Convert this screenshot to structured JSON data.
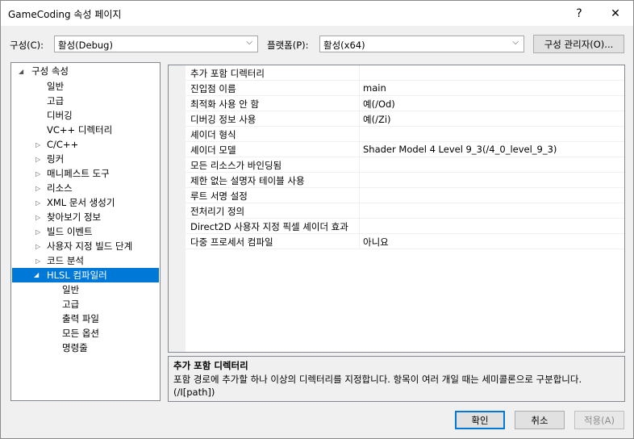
{
  "window": {
    "title": "GameCoding 속성 페이지",
    "help_glyph": "?",
    "close_glyph": "✕"
  },
  "toolbar": {
    "config_label": "구성(C):",
    "config_value": "활성(Debug)",
    "platform_label": "플랫폼(P):",
    "platform_value": "활성(x64)",
    "config_manager_label": "구성 관리자(O)..."
  },
  "tree": {
    "root": "구성 속성",
    "items": [
      "일반",
      "고급",
      "디버깅",
      "VC++ 디렉터리",
      "C/C++",
      "링커",
      "매니페스트 도구",
      "리소스",
      "XML 문서 생성기",
      "찾아보기 정보",
      "빌드 이벤트",
      "사용자 지정 빌드 단계",
      "코드 분석",
      "HLSL 컴파일러"
    ],
    "hlsl_children": [
      "일반",
      "고급",
      "출력 파일",
      "모든 옵션",
      "명령줄"
    ]
  },
  "properties": [
    {
      "name": "추가 포함 디렉터리",
      "value": ""
    },
    {
      "name": "진입점 이름",
      "value": "main"
    },
    {
      "name": "최적화 사용 안 함",
      "value": "예(/Od)"
    },
    {
      "name": "디버깅 정보 사용",
      "value": "예(/Zi)"
    },
    {
      "name": "셰이더 형식",
      "value": ""
    },
    {
      "name": "셰이더 모델",
      "value": "Shader Model 4 Level 9_3(/4_0_level_9_3)"
    },
    {
      "name": "모든 리소스가 바인딩됨",
      "value": ""
    },
    {
      "name": "제한 없는 설명자 테이블 사용",
      "value": ""
    },
    {
      "name": "루트 서명 설정",
      "value": ""
    },
    {
      "name": "전처리기 정의",
      "value": ""
    },
    {
      "name": "Direct2D 사용자 지정 픽셀 셰이더 효과",
      "value": ""
    },
    {
      "name": "다중 프로세서 컴파일",
      "value": "아니요"
    }
  ],
  "description": {
    "title": "추가 포함 디렉터리",
    "text": "포함 경로에 추가할 하나 이상의 디렉터리를 지정합니다. 항목이 여러 개일 때는 세미콜론으로 구분합니다. (/I[path])"
  },
  "buttons": {
    "ok": "확인",
    "cancel": "취소",
    "apply": "적용(A)"
  }
}
